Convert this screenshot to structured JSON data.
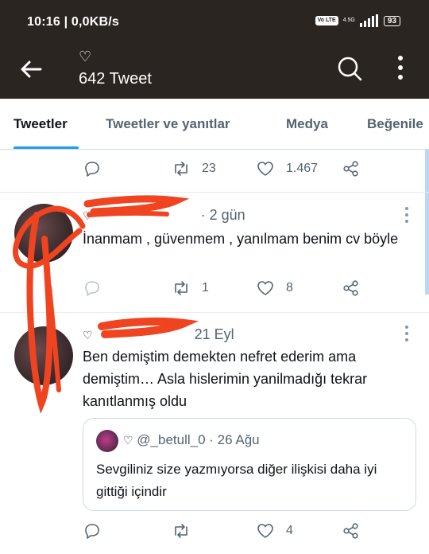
{
  "status_bar": {
    "time": "10:16 | 0,0KB/s",
    "volte": "Vo LTE",
    "network": "4.5G",
    "battery": "93"
  },
  "header": {
    "heart": "♡",
    "tweet_count": "642 Tweet",
    "icons": [
      "back-arrow-icon",
      "search-icon",
      "more-vertical-icon"
    ]
  },
  "tabs": [
    {
      "label": "Tweetler",
      "active": true
    },
    {
      "label": "Tweetler ve yanıtlar",
      "active": false
    },
    {
      "label": "Medya",
      "active": false
    },
    {
      "label": "Beğenile",
      "active": false
    }
  ],
  "accent_color": "#1d9bf0",
  "annotation_color": "#f0431f",
  "tweets": [
    {
      "header": "",
      "text": "",
      "retweets": "23",
      "likes": "1.467"
    },
    {
      "header_heart": "♡",
      "header_time": "· 2 gün",
      "text": "İnanmam , güvenmem , yanılmam benim cv böyle",
      "retweets": "1",
      "likes": "8"
    },
    {
      "header_heart": "♡",
      "header_time": "21 Eyl",
      "text": "Ben demiştim demekten nefret ederim ama demiştim… Asla hislerimin yanilmadığı tekrar kanıtlanmış oldu",
      "retweets": "",
      "likes": "4",
      "quote": {
        "heart": "♡",
        "handle": "@_betull_0",
        "time": "· 26 Ağu",
        "text": "Sevgiliniz size yazmıyorsa diğer ilişkisi daha iyi gittiği içindir"
      }
    }
  ]
}
